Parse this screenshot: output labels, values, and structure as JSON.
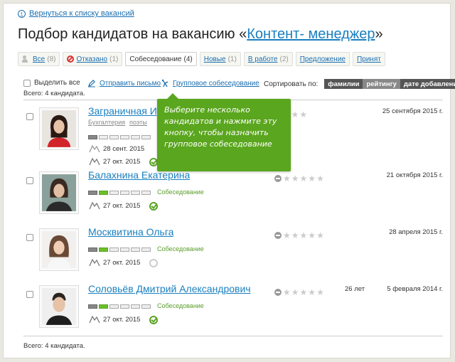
{
  "back_link": "Вернуться к списку вакансий",
  "title": {
    "prefix": "Подбор кандидатов на вакансию «",
    "vacancy": "Контент- менеджер",
    "suffix": "»"
  },
  "tabs": [
    {
      "label": "Все",
      "count": "(8)"
    },
    {
      "label": "Отказано",
      "count": "(1)"
    },
    {
      "label": "Собеседование",
      "count": "(4)"
    },
    {
      "label": "Новые",
      "count": "(1)"
    },
    {
      "label": "В работе",
      "count": "(2)"
    },
    {
      "label": "Предложение",
      "count": ""
    },
    {
      "label": "Принят",
      "count": ""
    }
  ],
  "toolbar": {
    "select_all": "Выделить все",
    "send_letter": "Отправить письмо",
    "group_interview": "Групповое собеседование",
    "sort_label": "Сортировать по:",
    "sort_options": [
      "фамилии",
      "рейтингу",
      "дате добавления"
    ]
  },
  "total_text": "Всего: 4 кандидата.",
  "tooltip": "Выберите несколько кандидатов и нажмите эту кнопку, чтобы назначить групповое собеседование",
  "candidates": [
    {
      "name": "Заграничная Ирина",
      "tags": [
        "Бухгалтерия",
        "поэты"
      ],
      "stage": "",
      "meet1": "28 сент. 2015",
      "meet2": "27 окт. 2015",
      "age": "",
      "date": "25 сентября 2015 г.",
      "rating": 1
    },
    {
      "name": "Балахнина Екатерина",
      "tags": [],
      "stage": "Собеседование",
      "meet1": "",
      "meet2": "27 окт. 2015",
      "age": "",
      "date": "21 октября 2015 г.",
      "rating": 0
    },
    {
      "name": "Москвитина Ольга",
      "tags": [],
      "stage": "Собеседование",
      "meet1": "",
      "meet2": "27 окт. 2015",
      "age": "",
      "date": "28 апреля 2015 г.",
      "rating": 0
    },
    {
      "name": "Соловьёв Дмитрий Александрович",
      "tags": [],
      "stage": "Собеседование",
      "meet1": "",
      "meet2": "27 окт. 2015",
      "age": "26 лет",
      "date": "5 февраля 2014 г.",
      "rating": 0
    }
  ],
  "colors": {
    "link": "#1a80c0",
    "green": "#5aa61e",
    "star": "#f2b90c"
  }
}
